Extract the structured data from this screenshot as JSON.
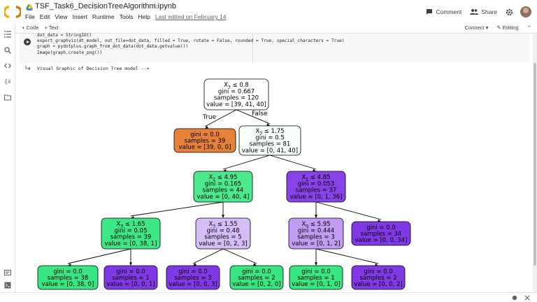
{
  "header": {
    "notebook_title": "TSF_Task6_DecisionTreeAlgorithm.ipynb",
    "menu": [
      "File",
      "Edit",
      "View",
      "Insert",
      "Runtime",
      "Tools",
      "Help"
    ],
    "last_edited": "Last edited on February 14",
    "comment_label": "Comment",
    "share_label": "Share"
  },
  "toolbar": {
    "code_label": "+ Code",
    "text_label": "+ Text",
    "connect_label": "Connect",
    "editing_label": "Editing"
  },
  "cell": {
    "code_lines": [
      "dot_data = StringIO()",
      "export_graphviz(dt_model, out_file=dot_data, filled = True, rotate = False, rounded = True, special_characters = True)",
      "graph = pydotplus.graph_from_dot_data(dot_data.getvalue())",
      "Image(graph.create_png())"
    ],
    "output_text": "Visual Graphic of Decision Tree model -->"
  },
  "tree": {
    "edge_labels": {
      "true": "True",
      "false": "False"
    },
    "nodes": [
      {
        "id": "n0",
        "fill": "#ffffff",
        "lines": [
          "X3 ≤ 0.8",
          "gini = 0.667",
          "samples = 120",
          "value = [39, 41, 40]"
        ],
        "feature": "X",
        "sub": "3",
        "rest": " ≤ 0.8"
      },
      {
        "id": "n1",
        "fill": "#e58139",
        "lines": [
          "gini = 0.0",
          "samples = 39",
          "value = [39, 0, 0]"
        ]
      },
      {
        "id": "n2",
        "fill": "#f7fefa",
        "lines": [
          "X3 ≤ 1.75",
          "gini = 0.5",
          "samples = 81",
          "value = [0, 41, 40]"
        ],
        "feature": "X",
        "sub": "3",
        "rest": " ≤ 1.75"
      },
      {
        "id": "n3",
        "fill": "#4de88e",
        "lines": [
          "X2 ≤ 4.95",
          "gini = 0.165",
          "samples = 44",
          "value = [0, 40, 4]"
        ],
        "feature": "X",
        "sub": "2",
        "rest": " ≤ 4.95"
      },
      {
        "id": "n4",
        "fill": "#8743e6",
        "lines": [
          "X2 ≤ 4.85",
          "gini = 0.053",
          "samples = 37",
          "value = [0, 1, 36]"
        ],
        "feature": "X",
        "sub": "2",
        "rest": " ≤ 4.85"
      },
      {
        "id": "n5",
        "fill": "#3fe685",
        "lines": [
          "X3 ≤ 1.65",
          "gini = 0.05",
          "samples = 39",
          "value = [0, 38, 1]"
        ],
        "feature": "X",
        "sub": "3",
        "rest": " ≤ 1.65"
      },
      {
        "id": "n6",
        "fill": "#d5bdf6",
        "lines": [
          "X3 ≤ 1.55",
          "gini = 0.48",
          "samples = 5",
          "value = [0, 2, 3]"
        ],
        "feature": "X",
        "sub": "3",
        "rest": " ≤ 1.55"
      },
      {
        "id": "n7",
        "fill": "#c09cf2",
        "lines": [
          "X0 ≤ 5.95",
          "gini = 0.444",
          "samples = 3",
          "value = [0, 1, 2]"
        ],
        "feature": "X",
        "sub": "0",
        "rest": " ≤ 5.95"
      },
      {
        "id": "n8",
        "fill": "#8139e5",
        "lines": [
          "gini = 0.0",
          "samples = 34",
          "value = [0, 0, 34]"
        ]
      },
      {
        "id": "n9",
        "fill": "#39e581",
        "lines": [
          "gini = 0.0",
          "samples = 38",
          "value = [0, 38, 0]"
        ]
      },
      {
        "id": "n10",
        "fill": "#8139e5",
        "lines": [
          "gini = 0.0",
          "samples = 1",
          "value = [0, 0, 1]"
        ]
      },
      {
        "id": "n11",
        "fill": "#8139e5",
        "lines": [
          "gini = 0.0",
          "samples = 3",
          "value = [0, 0, 3]"
        ]
      },
      {
        "id": "n12",
        "fill": "#39e581",
        "lines": [
          "gini = 0.0",
          "samples = 2",
          "value = [0, 2, 0]"
        ]
      },
      {
        "id": "n13",
        "fill": "#39e581",
        "lines": [
          "gini = 0.0",
          "samples = 1",
          "value = [0, 1, 0]"
        ]
      },
      {
        "id": "n14",
        "fill": "#8139e5",
        "lines": [
          "gini = 0.0",
          "samples = 2",
          "value = [0, 0, 2]"
        ]
      }
    ],
    "edges": [
      [
        "n0",
        "n1"
      ],
      [
        "n0",
        "n2"
      ],
      [
        "n2",
        "n3"
      ],
      [
        "n2",
        "n4"
      ],
      [
        "n3",
        "n5"
      ],
      [
        "n3",
        "n6"
      ],
      [
        "n4",
        "n7"
      ],
      [
        "n4",
        "n8"
      ],
      [
        "n5",
        "n9"
      ],
      [
        "n5",
        "n10"
      ],
      [
        "n6",
        "n11"
      ],
      [
        "n6",
        "n12"
      ],
      [
        "n7",
        "n13"
      ],
      [
        "n7",
        "n14"
      ]
    ]
  }
}
